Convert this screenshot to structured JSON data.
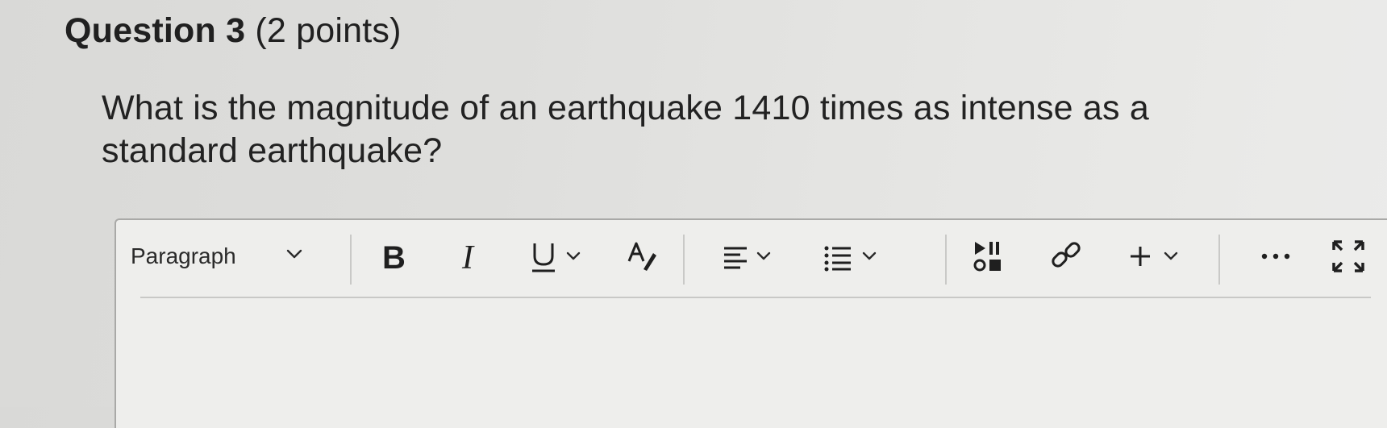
{
  "question": {
    "title": "Question 3",
    "points": "(2 points)",
    "text": "What is the magnitude of an earthquake 1410 times as intense as a standard earthquake?"
  },
  "editor": {
    "toolbar": {
      "paragraph_label": "Paragraph",
      "icons": {
        "paragraph_dropdown": "chevron-down-icon",
        "bold": "bold-icon",
        "italic": "italic-icon",
        "underline": "underline-icon",
        "underline_dropdown": "chevron-down-icon",
        "format": "text-format-icon",
        "align": "align-icon",
        "align_dropdown": "chevron-down-icon",
        "list": "list-icon",
        "list_dropdown": "chevron-down-icon",
        "media": "media-icon",
        "link": "link-icon",
        "insert": "plus-icon",
        "insert_dropdown": "chevron-down-icon",
        "more": "more-icon",
        "fullscreen": "fullscreen-icon"
      }
    },
    "body_text": ""
  }
}
